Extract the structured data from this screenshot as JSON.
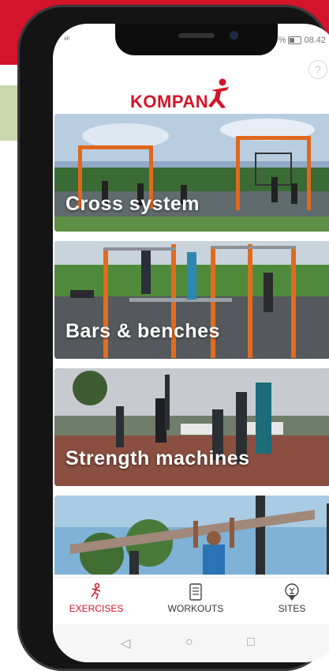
{
  "status_bar": {
    "signal": "ᵉᵃᴵᴵ",
    "battery_pct": "%",
    "time": "08.42"
  },
  "app": {
    "brand": "KOMPAN",
    "help_icon": "question-icon",
    "accent": "#d3142a"
  },
  "cards": [
    {
      "label": "Cross system"
    },
    {
      "label": "Bars & benches"
    },
    {
      "label": "Strength machines"
    },
    {
      "label": ""
    }
  ],
  "bottom_nav": {
    "items": [
      {
        "label": "EXERCISES",
        "icon": "exercise-figure-icon",
        "active": true
      },
      {
        "label": "WORKOUTS",
        "icon": "workout-list-icon",
        "active": false
      },
      {
        "label": "SITES",
        "icon": "location-pin-icon",
        "active": false
      }
    ]
  },
  "system_nav": {
    "back": "◁",
    "home": "○",
    "recents": "□"
  }
}
